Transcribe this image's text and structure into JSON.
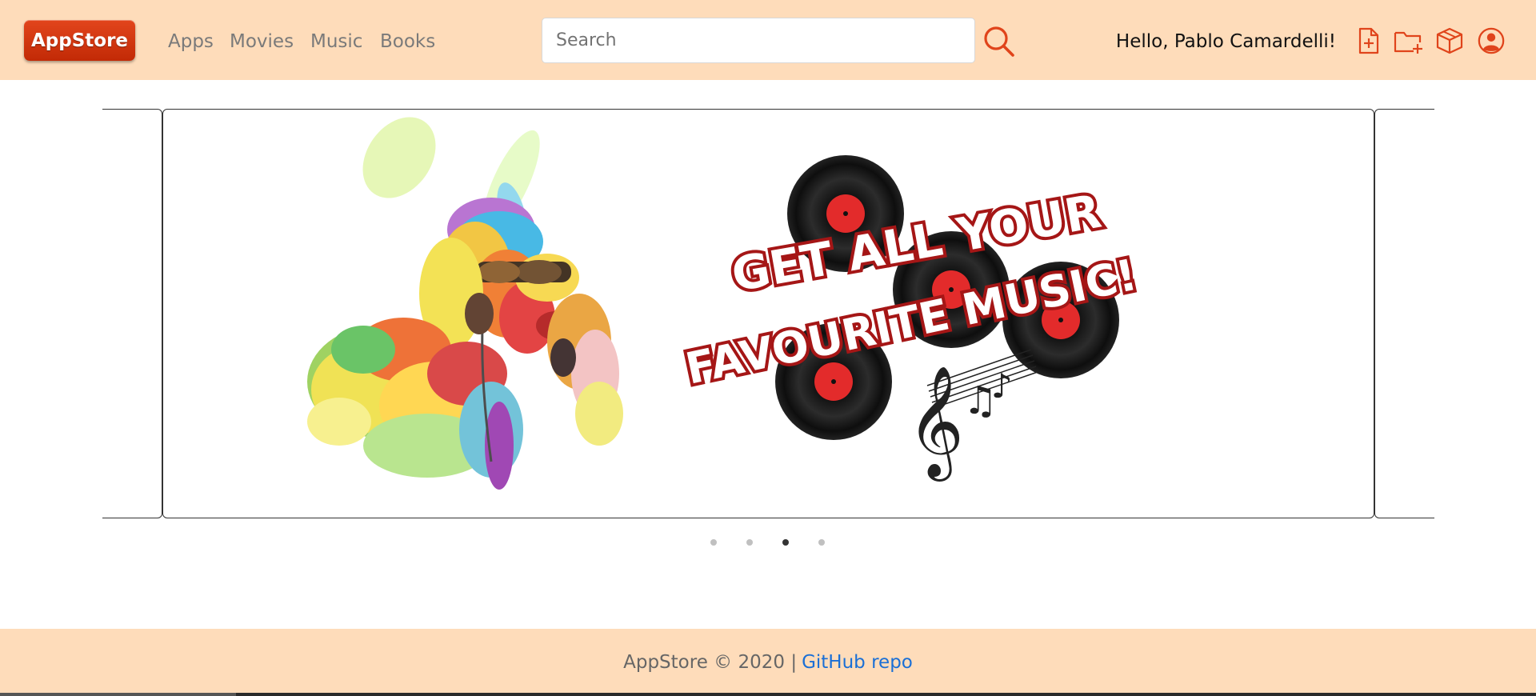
{
  "header": {
    "logo_text": "AppStore",
    "nav": [
      "Apps",
      "Movies",
      "Music",
      "Books"
    ],
    "search_placeholder": "Search",
    "greeting": "Hello, Pablo Camardelli!",
    "icons": [
      "file-plus-icon",
      "folder-plus-icon",
      "box-icon",
      "user-circle-icon"
    ],
    "accent": "#e0441b",
    "background": "#fedcba"
  },
  "carousel": {
    "slide_text_line1": "GET ALL YOUR",
    "slide_text_line2": "FAVOURITE MUSIC!",
    "slide_count": 4,
    "active_slide": 3
  },
  "footer": {
    "text": "AppStore © 2020 |",
    "link_text": "GitHub repo",
    "link_color": "#1a6fd6"
  }
}
